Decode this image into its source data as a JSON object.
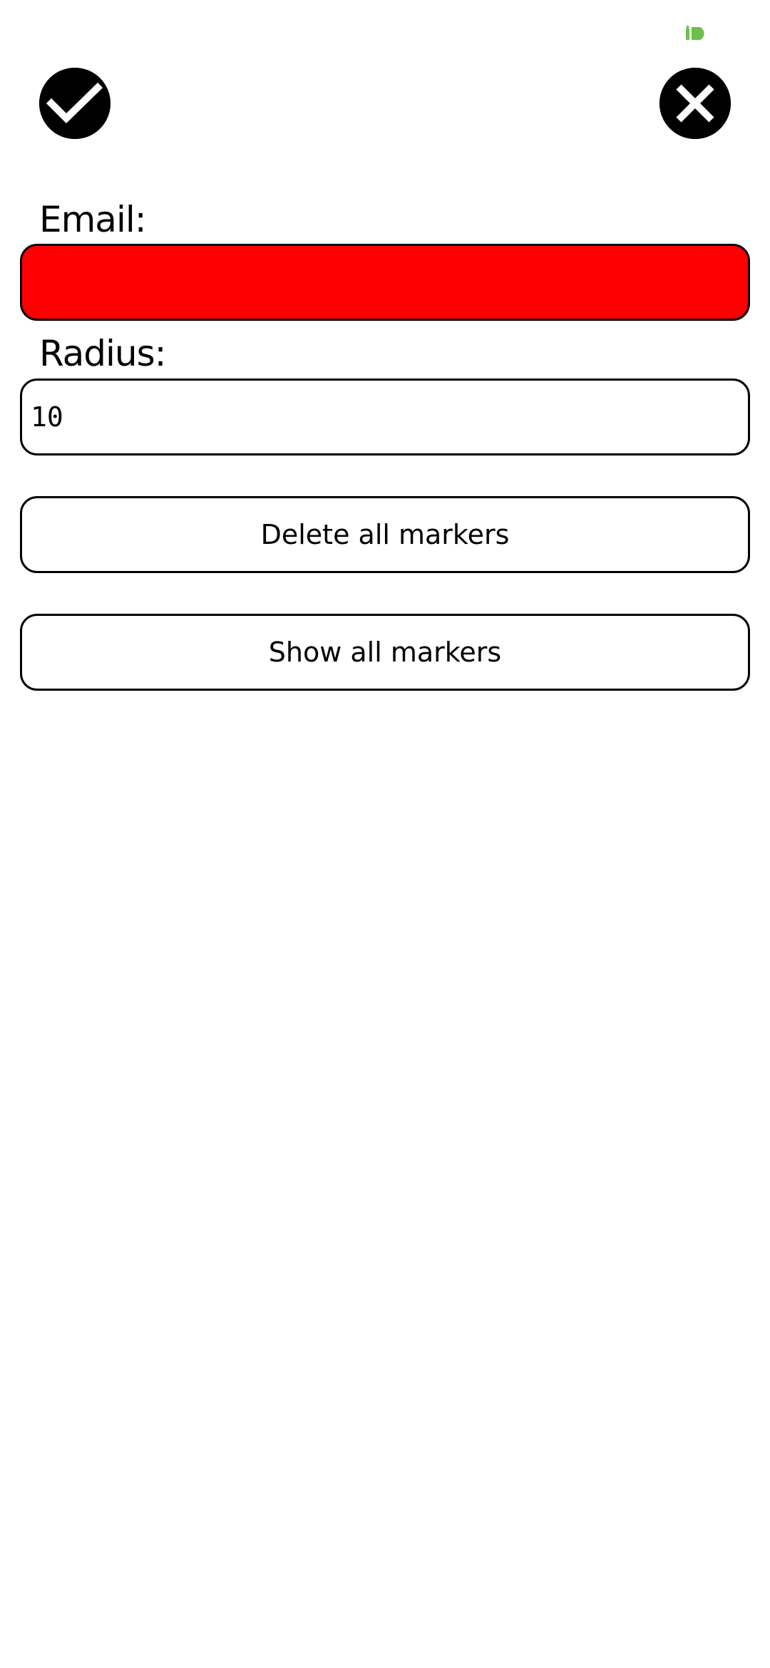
{
  "status_bar": {
    "indicator_icon": "id-badge-icon",
    "indicator_color": "#6cc04a"
  },
  "toolbar": {
    "confirm_icon": "checkmark-icon",
    "cancel_icon": "close-icon"
  },
  "form": {
    "email": {
      "label": "Email:",
      "value": "",
      "placeholder": "",
      "background_color": "#ff0000"
    },
    "radius": {
      "label": "Radius:",
      "value": "10"
    }
  },
  "actions": {
    "delete_all_markers_label": "Delete all markers",
    "show_all_markers_label": "Show all markers"
  },
  "colors": {
    "background": "#ffffff",
    "foreground": "#000000",
    "error": "#ff0000"
  }
}
